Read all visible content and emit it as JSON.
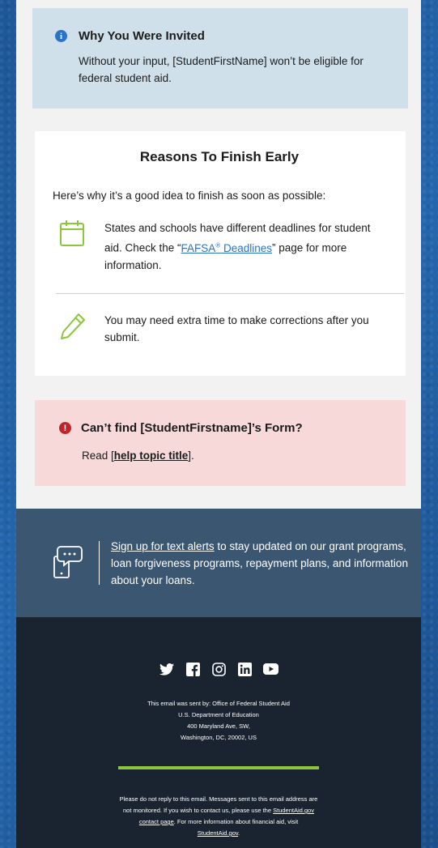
{
  "invite": {
    "title": "Why You Were Invited",
    "body": "Without your input, [StudentFirstName] won’t be eligible for federal student aid."
  },
  "reasons": {
    "title": "Reasons To Finish Early",
    "intro": "Here’s why it’s a good idea to finish as soon as possible:",
    "item1_before": "States and schools have different deadlines for student aid. Check the “",
    "item1_link": "FAFSA",
    "item1_link_sup": "®",
    "item1_link_rest": " Deadlines",
    "item1_after": "” page for more information.",
    "item2": "You may need extra time to make corrections after you submit."
  },
  "cant_find": {
    "title": "Can’t find [StudentFirstname]’s Form?",
    "before": "Read [",
    "link": "help topic title",
    "after": "]."
  },
  "alerts": {
    "link": "Sign up for text alerts",
    "text": " to stay updated on our grant programs, loan forgiveness programs, repayment plans, and information about your loans."
  },
  "footer": {
    "social_icons": [
      "twitter-icon",
      "facebook-icon",
      "instagram-icon",
      "linkedin-icon",
      "youtube-icon"
    ],
    "sender_lines": [
      "This email was sent by: Office of Federal Student Aid",
      "U.S. Department of Education",
      "400 Maryland Ave, SW,",
      "Washington, DC, 20002, US"
    ],
    "disclaimer_before": "Please do not reply to this email. Messages sent to this email address are not monitored. If you wish to contact us, please use the ",
    "disclaimer_link1": "StudentAid.gov contact page",
    "disclaimer_middle": ". For more information about financial aid, visit ",
    "disclaimer_link2": "StudentAid.gov",
    "disclaimer_after": "."
  },
  "colors": {
    "info_blue": "#2a73c7",
    "accent_green": "#8cc63f",
    "error_red": "#c4222a"
  }
}
